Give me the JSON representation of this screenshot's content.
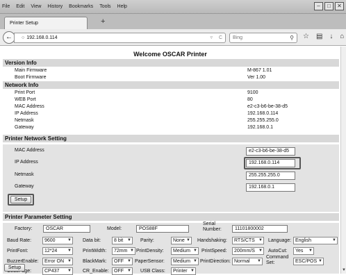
{
  "menu": {
    "file": "File",
    "edit": "Edit",
    "view": "View",
    "history": "History",
    "bookmarks": "Bookmarks",
    "tools": "Tools",
    "help": "Help"
  },
  "tab": {
    "title": "Printer Setup",
    "new_tab": "+"
  },
  "nav": {
    "url": "192.168.0.114",
    "search_placeholder": "Bing"
  },
  "page": {
    "title": "Welcome OSCAR Printer"
  },
  "version": {
    "header": "Version Info",
    "rows": [
      {
        "label": "Main Firmware",
        "value": "M-867 1.01"
      },
      {
        "label": "Boot Firmware",
        "value": "Ver 1.00"
      }
    ]
  },
  "network": {
    "header": "Network Info",
    "rows": [
      {
        "label": "Print Port",
        "value": "9100"
      },
      {
        "label": "WEB Port",
        "value": "80"
      },
      {
        "label": "MAC Address",
        "value": "e2-c3-b6-be-38-d5"
      },
      {
        "label": "IP Address",
        "value": "192.168.0.114"
      },
      {
        "label": "Netmask",
        "value": "255.255.255.0"
      },
      {
        "label": "Gateway",
        "value": "192.168.0.1"
      }
    ]
  },
  "netset": {
    "header": "Printer Network Setting",
    "mac_label": "MAC Address",
    "mac_value": "e2-c3-b6-be-38-d5",
    "ip_label": "IP Address",
    "ip_value": "192.168.0.114",
    "netmask_label": "Netmask",
    "netmask_value": "255.255.255.0",
    "gateway_label": "Gateway",
    "gateway_value": "192.168.0.1",
    "setup": "Setup"
  },
  "params": {
    "header": "Printer Parameter Setting",
    "factory_label": "Factory:",
    "factory_value": "OSCAR",
    "model_label": "Model:",
    "model_value": "POS88F",
    "serial_label_1": "Serial",
    "serial_label_2": "Number:",
    "serial_value": "11101800002",
    "baud_label": "Baud Rate:",
    "baud_value": "9600",
    "databit_label": "Data bit:",
    "databit_value": "8 bit",
    "parity_label": "Parity:",
    "parity_value": "None",
    "handshake_label": "Handshaking:",
    "handshake_value": "RTS/CTS",
    "language_label": "Language:",
    "language_value": "English",
    "printfont_label": "PrintFont:",
    "printfont_value": "12*24",
    "printwidth_label": "PrintWidth:",
    "printwidth_value": "72mm",
    "density_label": "PrintDensity:",
    "density_value": "Medium",
    "speed_label": "PrintSpeed:",
    "speed_value": "200mm/S",
    "autocut_label": "AutoCut:",
    "autocut_value": "Yes",
    "buzzer_label": "BuzzerEnable:",
    "buzzer_value": "Error ON",
    "blackmark_label": "BlackMark:",
    "blackmark_value": "OFF",
    "papersensor_label": "PaperSensor:",
    "papersensor_value": "Medium",
    "direction_label": "PrintDirection:",
    "direction_value": "Normal",
    "cmdset_label_1": "Command",
    "cmdset_label_2": "Set:",
    "cmdset_value": "ESC/POS",
    "codepage_label": "CodePage:",
    "codepage_value": "CP437",
    "crenable_label": "CR_Enable:",
    "crenable_value": "OFF",
    "usbclass_label": "USB Class:",
    "usbclass_value": "Printer",
    "setup": "Setup"
  }
}
